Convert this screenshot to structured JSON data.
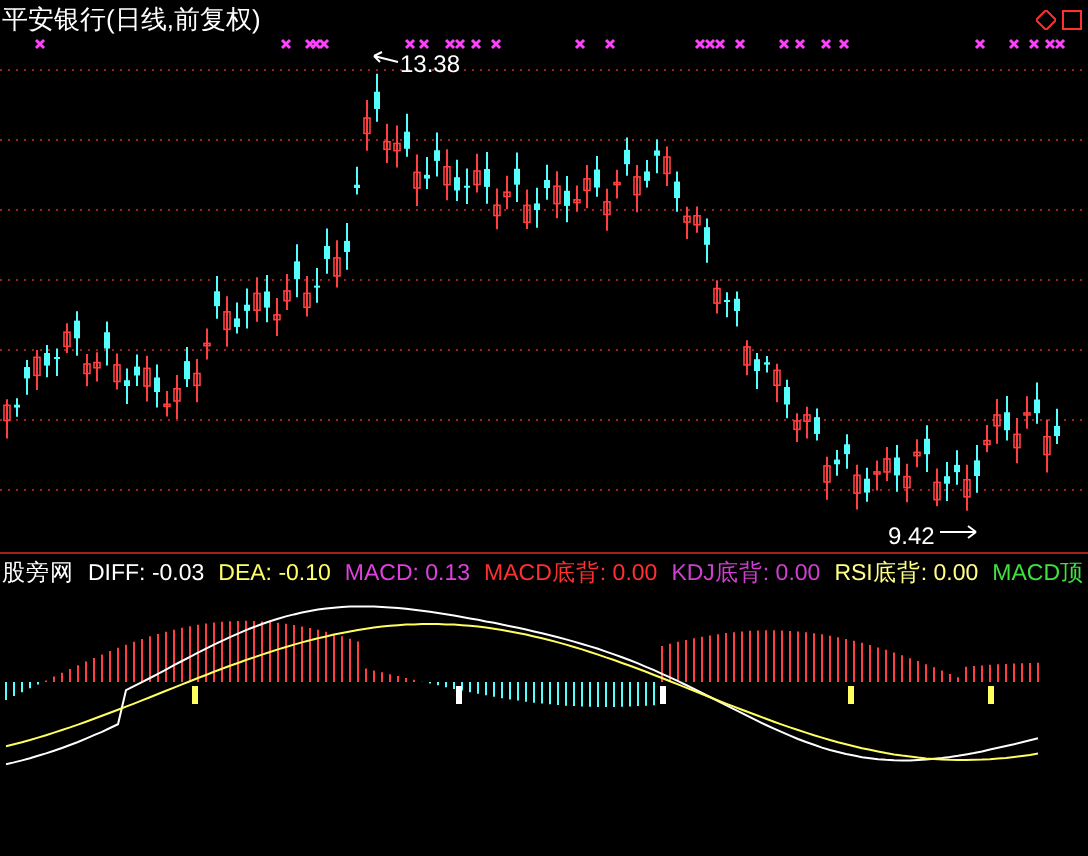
{
  "chart_title": "平安银行(日线,前复权)",
  "price_annotations": [
    {
      "kind": "high",
      "text": "13.38"
    },
    {
      "kind": "low",
      "text": "9.42"
    }
  ],
  "indicator_name": "股旁网",
  "indicator_values": [
    {
      "text": "DIFF: -0.03",
      "color": "#ffffff"
    },
    {
      "text": "DEA: -0.10",
      "color": "#ffff66"
    },
    {
      "text": "MACD: 0.13",
      "color": "#e040e0"
    },
    {
      "text": "MACD底背: 0.00",
      "color": "#ff3030"
    },
    {
      "text": "KDJ底背: 0.00",
      "color": "#d040d0"
    },
    {
      "text": "RSI底背: 0.00",
      "color": "#ffff88"
    },
    {
      "text": "MACD顶",
      "color": "#40e040"
    }
  ]
}
